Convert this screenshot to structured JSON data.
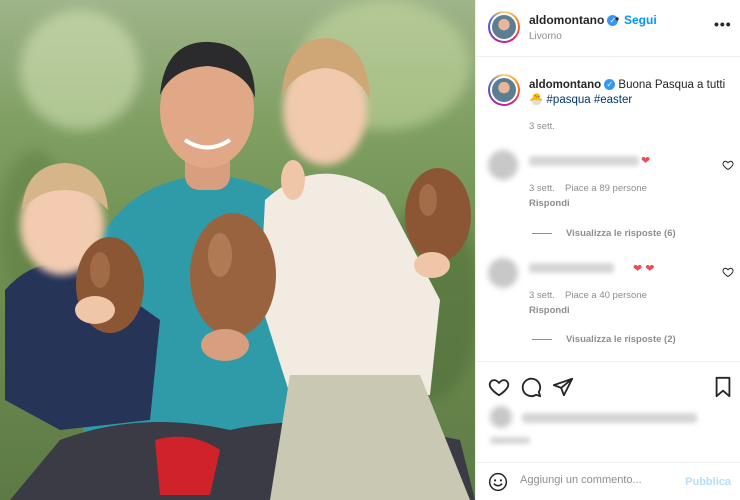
{
  "post": {
    "username": "aldomontano",
    "location": "Livorno",
    "follow_label": "Segui",
    "separator": "•",
    "more_label": "•••"
  },
  "caption": {
    "username": "aldomontano",
    "text": "Buona Pasqua a tutti",
    "emoji": "🐣",
    "hashtags": "#pasqua #easter",
    "time": "3 sett."
  },
  "comments": [
    {
      "time": "3 sett.",
      "likes": "Piace a 89 persone",
      "reply_label": "Rispondi",
      "view_replies": "Visualizza le risposte (6)",
      "hearts": "❤"
    },
    {
      "time": "3 sett.",
      "likes": "Piace a 40 persone",
      "reply_label": "Rispondi",
      "view_replies": "Visualizza le risposte (2)",
      "hearts": "❤ ❤"
    }
  ],
  "comment_bar": {
    "placeholder": "Aggiungi un commento...",
    "publish_label": "Pubblica"
  },
  "icons": {
    "like": "heart-icon",
    "comment": "comment-icon",
    "share": "share-icon",
    "save": "bookmark-icon",
    "emoji": "emoji-icon",
    "verified": "verified-badge-icon"
  },
  "colors": {
    "accent": "#0095f6",
    "verified": "#3897f0",
    "heart": "#ed4956",
    "muted": "#8e8e8e"
  }
}
